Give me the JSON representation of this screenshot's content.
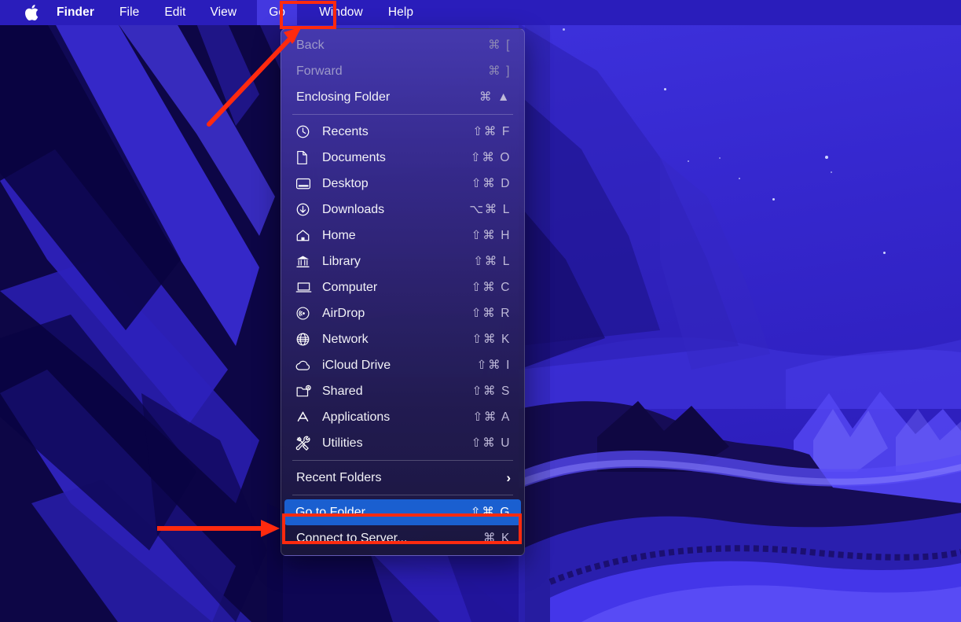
{
  "menubar": {
    "apple_icon": "apple-logo-icon",
    "items": [
      {
        "id": "finder",
        "label": "Finder",
        "bold": true,
        "active": false
      },
      {
        "id": "file",
        "label": "File",
        "bold": false,
        "active": false
      },
      {
        "id": "edit",
        "label": "Edit",
        "bold": false,
        "active": false
      },
      {
        "id": "view",
        "label": "View",
        "bold": false,
        "active": false
      },
      {
        "id": "go",
        "label": "Go",
        "bold": false,
        "active": true
      },
      {
        "id": "window",
        "label": "Window",
        "bold": false,
        "active": false
      },
      {
        "id": "help",
        "label": "Help",
        "bold": false,
        "active": false
      }
    ]
  },
  "go_menu": {
    "groups": [
      {
        "items": [
          {
            "label": "Back",
            "shortcut": "⌘ [",
            "icon": null,
            "disabled": true,
            "selected": false,
            "submenu": false
          },
          {
            "label": "Forward",
            "shortcut": "⌘ ]",
            "icon": null,
            "disabled": true,
            "selected": false,
            "submenu": false
          },
          {
            "label": "Enclosing Folder",
            "shortcut": "⌘ ▲",
            "icon": null,
            "disabled": false,
            "selected": false,
            "submenu": false
          }
        ]
      },
      {
        "items": [
          {
            "label": "Recents",
            "shortcut": "⇧⌘ F",
            "icon": "clock-icon",
            "disabled": false,
            "selected": false,
            "submenu": false
          },
          {
            "label": "Documents",
            "shortcut": "⇧⌘ O",
            "icon": "document-icon",
            "disabled": false,
            "selected": false,
            "submenu": false
          },
          {
            "label": "Desktop",
            "shortcut": "⇧⌘ D",
            "icon": "desktop-icon",
            "disabled": false,
            "selected": false,
            "submenu": false
          },
          {
            "label": "Downloads",
            "shortcut": "⌥⌘ L",
            "icon": "download-icon",
            "disabled": false,
            "selected": false,
            "submenu": false
          },
          {
            "label": "Home",
            "shortcut": "⇧⌘ H",
            "icon": "home-icon",
            "disabled": false,
            "selected": false,
            "submenu": false
          },
          {
            "label": "Library",
            "shortcut": "⇧⌘ L",
            "icon": "library-icon",
            "disabled": false,
            "selected": false,
            "submenu": false
          },
          {
            "label": "Computer",
            "shortcut": "⇧⌘ C",
            "icon": "computer-icon",
            "disabled": false,
            "selected": false,
            "submenu": false
          },
          {
            "label": "AirDrop",
            "shortcut": "⇧⌘ R",
            "icon": "airdrop-icon",
            "disabled": false,
            "selected": false,
            "submenu": false
          },
          {
            "label": "Network",
            "shortcut": "⇧⌘ K",
            "icon": "globe-icon",
            "disabled": false,
            "selected": false,
            "submenu": false
          },
          {
            "label": "iCloud Drive",
            "shortcut": "⇧⌘ I",
            "icon": "cloud-icon",
            "disabled": false,
            "selected": false,
            "submenu": false
          },
          {
            "label": "Shared",
            "shortcut": "⇧⌘ S",
            "icon": "shared-folder-icon",
            "disabled": false,
            "selected": false,
            "submenu": false
          },
          {
            "label": "Applications",
            "shortcut": "⇧⌘ A",
            "icon": "applications-icon",
            "disabled": false,
            "selected": false,
            "submenu": false
          },
          {
            "label": "Utilities",
            "shortcut": "⇧⌘ U",
            "icon": "utilities-icon",
            "disabled": false,
            "selected": false,
            "submenu": false
          }
        ]
      },
      {
        "items": [
          {
            "label": "Recent Folders",
            "shortcut": "",
            "icon": null,
            "disabled": false,
            "selected": false,
            "submenu": true
          }
        ]
      },
      {
        "items": [
          {
            "label": "Go to Folder...",
            "shortcut": "⇧⌘ G",
            "icon": null,
            "disabled": false,
            "selected": true,
            "submenu": false
          },
          {
            "label": "Connect to Server...",
            "shortcut": "⌘ K",
            "icon": null,
            "disabled": false,
            "selected": false,
            "submenu": false
          }
        ]
      }
    ]
  },
  "annotations": {
    "highlight_color": "#ff2a0f",
    "selection_color": "#1a5fd0",
    "boxes": [
      {
        "name": "go-menu-highlight-box",
        "target": "Go"
      },
      {
        "name": "go-to-folder-highlight-box",
        "target": "Go to Folder..."
      }
    ],
    "arrows": [
      {
        "name": "arrow-to-go-menu",
        "direction": "up-right"
      },
      {
        "name": "arrow-to-go-to-folder",
        "direction": "right"
      }
    ]
  },
  "desktop": {
    "wallpaper_name": "big-sur-mountains-night-blue",
    "menubar_color": "#2a1dbb",
    "sky_color": "#3a2fd8"
  }
}
